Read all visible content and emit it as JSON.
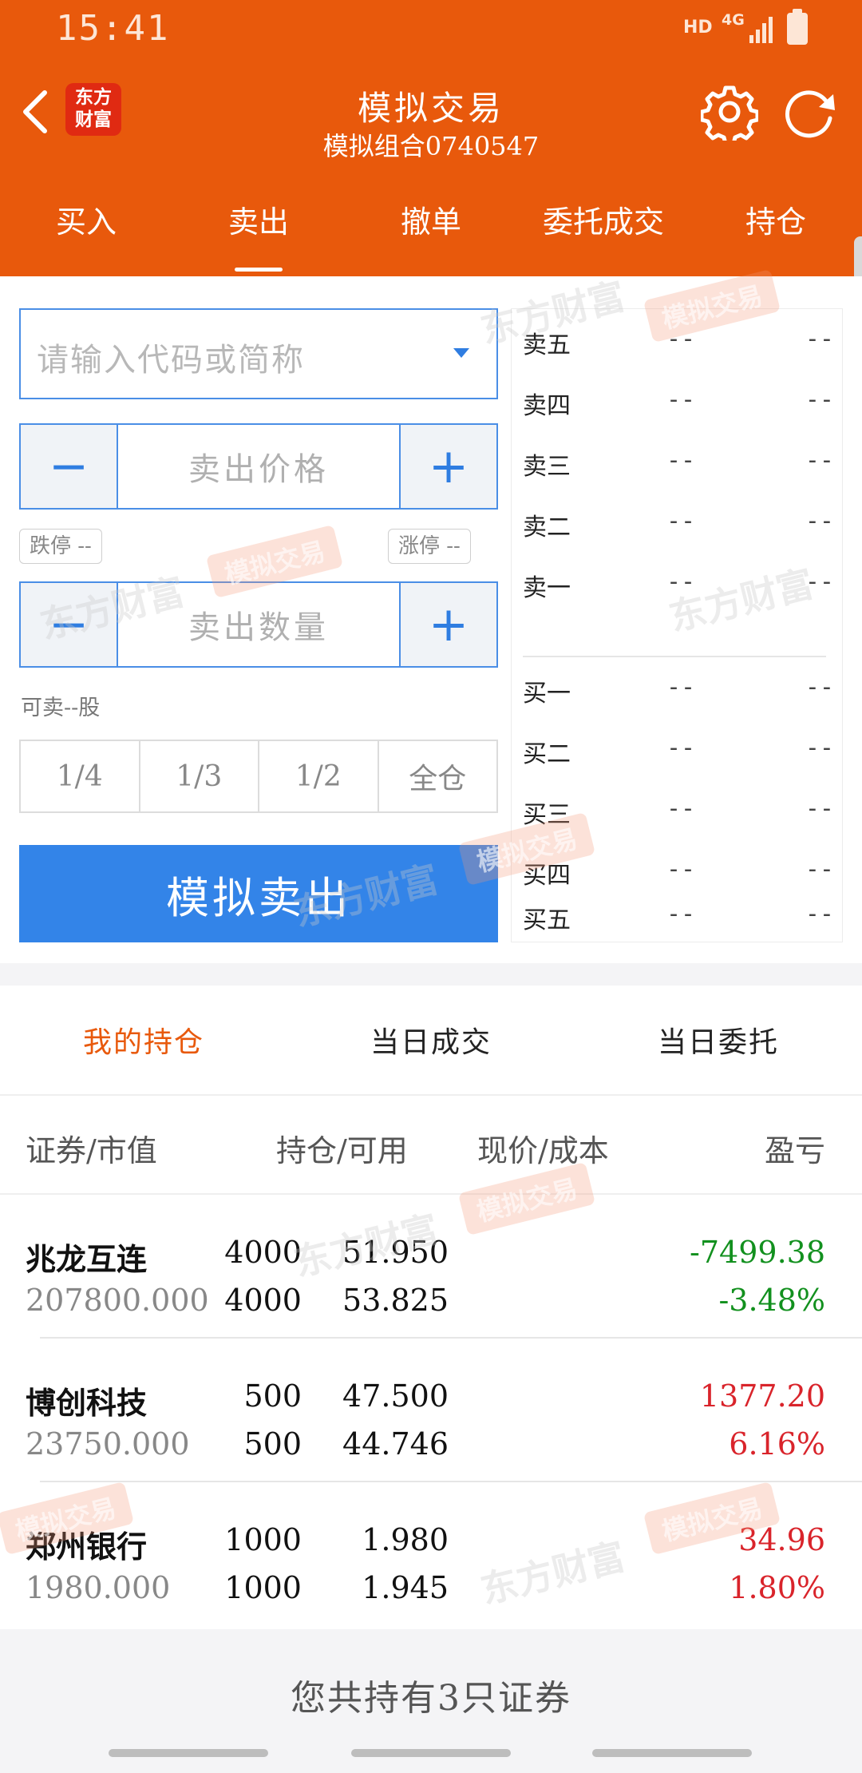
{
  "status_bar": {
    "time": "15:41",
    "hd": "HD",
    "network": "4G"
  },
  "header": {
    "logo_line1": "东方",
    "logo_line2": "财富",
    "title": "模拟交易",
    "subtitle": "模拟组合0740547",
    "accent_color": "#e8590c"
  },
  "tabs": [
    {
      "label": "买入"
    },
    {
      "label": "卖出"
    },
    {
      "label": "撤单"
    },
    {
      "label": "委托成交"
    },
    {
      "label": "持仓"
    }
  ],
  "active_tab": "卖出",
  "trade_form": {
    "code_placeholder": "请输入代码或简称",
    "price_placeholder": "卖出价格",
    "quantity_placeholder": "卖出数量",
    "minus": "−",
    "plus": "+",
    "limit_down": "跌停 --",
    "limit_up": "涨停 --",
    "can_sell": "可卖--股",
    "fractions": [
      "1/4",
      "1/3",
      "1/2",
      "全仓"
    ],
    "submit": "模拟卖出",
    "button_color": "#3384e8"
  },
  "watermark": {
    "brand": "东方财富",
    "badge": "模拟交易"
  },
  "order_book": {
    "sell": [
      {
        "label": "卖五",
        "price": "--",
        "volume": "--"
      },
      {
        "label": "卖四",
        "price": "--",
        "volume": "--"
      },
      {
        "label": "卖三",
        "price": "--",
        "volume": "--"
      },
      {
        "label": "卖二",
        "price": "--",
        "volume": "--"
      },
      {
        "label": "卖一",
        "price": "--",
        "volume": "--"
      }
    ],
    "buy": [
      {
        "label": "买一",
        "price": "--",
        "volume": "--"
      },
      {
        "label": "买二",
        "price": "--",
        "volume": "--"
      },
      {
        "label": "买三",
        "price": "--",
        "volume": "--"
      },
      {
        "label": "买四",
        "price": "--",
        "volume": "--"
      },
      {
        "label": "买五",
        "price": "--",
        "volume": "--"
      }
    ]
  },
  "positions": {
    "sub_tabs": [
      {
        "label": "我的持仓"
      },
      {
        "label": "当日成交"
      },
      {
        "label": "当日委托"
      }
    ],
    "columns": {
      "security": "证券/市值",
      "holding": "持仓/可用",
      "price": "现价/成本",
      "pl": "盈亏"
    },
    "rows": [
      {
        "name": "兆龙互连",
        "market_value": "207800.000",
        "holding": "4000",
        "available": "4000",
        "price": "51.950",
        "cost": "53.825",
        "pl": "-7499.38",
        "pl_pct": "-3.48%",
        "trend": "loss"
      },
      {
        "name": "博创科技",
        "market_value": "23750.000",
        "holding": "500",
        "available": "500",
        "price": "47.500",
        "cost": "44.746",
        "pl": "1377.20",
        "pl_pct": "6.16%",
        "trend": "gain"
      },
      {
        "name": "郑州银行",
        "market_value": "1980.000",
        "holding": "1000",
        "available": "1000",
        "price": "1.980",
        "cost": "1.945",
        "pl": "34.96",
        "pl_pct": "1.80%",
        "trend": "gain"
      }
    ],
    "summary": "您共持有3只证券",
    "gain_color": "#d9242b",
    "loss_color": "#12901e"
  }
}
